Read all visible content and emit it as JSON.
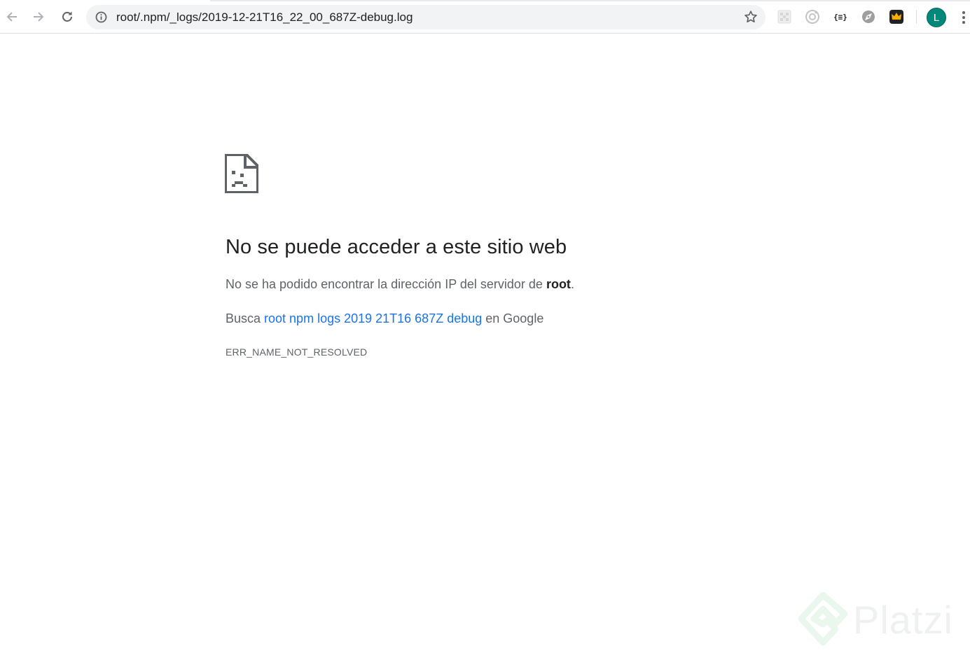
{
  "browser": {
    "url": "root/.npm/_logs/2019-12-21T16_22_00_687Z-debug.log",
    "profile_initial": "L",
    "accent_color": "#00897b",
    "icons": [
      "back-arrow-icon",
      "forward-arrow-icon",
      "reload-icon",
      "info-icon",
      "star-icon",
      "menu-dots-icon"
    ],
    "extensions": [
      "grid-extension-icon",
      "camera-extension-icon",
      "json-extension-icon",
      "compass-extension-icon",
      "crown-extension-icon"
    ],
    "json_ext_label": "{≡}"
  },
  "error_page": {
    "title": "No se puede acceder a este sitio web",
    "description_prefix": "No se ha podido encontrar la dirección IP del servidor de ",
    "host": "root",
    "description_suffix": ".",
    "suggest_prefix": "Busca ",
    "suggest_link": "root npm logs 2019 21T16 687Z debug",
    "suggest_suffix": " en Google",
    "error_code": "ERR_NAME_NOT_RESOLVED",
    "link_color": "#1a73e8"
  },
  "watermark": {
    "text": "Platzi"
  }
}
